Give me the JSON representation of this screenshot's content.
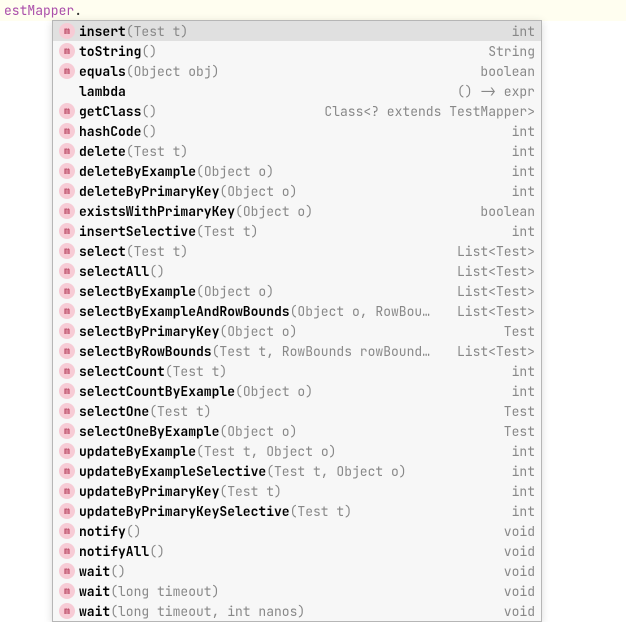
{
  "code_line": {
    "prefix": "estMapper",
    "dot": "."
  },
  "popup": {
    "rows": [
      {
        "icon": "m",
        "name": "insert",
        "params": "(Test t)",
        "ret": "int",
        "selected": true
      },
      {
        "icon": "m",
        "name": "toString",
        "params": "()",
        "ret": "String",
        "selected": false
      },
      {
        "icon": "m",
        "name": "equals",
        "params": "(Object obj)",
        "ret": "boolean",
        "selected": false
      },
      {
        "icon": "",
        "name": "lambda",
        "params": "",
        "ret": "() -> expr",
        "selected": false
      },
      {
        "icon": "m",
        "name": "getClass",
        "params": "()",
        "ret": "Class<? extends TestMapper>",
        "selected": false
      },
      {
        "icon": "m",
        "name": "hashCode",
        "params": "()",
        "ret": "int",
        "selected": false
      },
      {
        "icon": "m",
        "name": "delete",
        "params": "(Test t)",
        "ret": "int",
        "selected": false
      },
      {
        "icon": "m",
        "name": "deleteByExample",
        "params": "(Object o)",
        "ret": "int",
        "selected": false
      },
      {
        "icon": "m",
        "name": "deleteByPrimaryKey",
        "params": "(Object o)",
        "ret": "int",
        "selected": false
      },
      {
        "icon": "m",
        "name": "existsWithPrimaryKey",
        "params": "(Object o)",
        "ret": "boolean",
        "selected": false
      },
      {
        "icon": "m",
        "name": "insertSelective",
        "params": "(Test t)",
        "ret": "int",
        "selected": false
      },
      {
        "icon": "m",
        "name": "select",
        "params": "(Test t)",
        "ret": "List<Test>",
        "selected": false
      },
      {
        "icon": "m",
        "name": "selectAll",
        "params": "()",
        "ret": "List<Test>",
        "selected": false
      },
      {
        "icon": "m",
        "name": "selectByExample",
        "params": "(Object o)",
        "ret": "List<Test>",
        "selected": false
      },
      {
        "icon": "m",
        "name": "selectByExampleAndRowBounds",
        "params": "(Object o, RowBou…",
        "ret": "List<Test>",
        "selected": false
      },
      {
        "icon": "m",
        "name": "selectByPrimaryKey",
        "params": "(Object o)",
        "ret": "Test",
        "selected": false
      },
      {
        "icon": "m",
        "name": "selectByRowBounds",
        "params": "(Test t, RowBounds rowBound…",
        "ret": "List<Test>",
        "selected": false
      },
      {
        "icon": "m",
        "name": "selectCount",
        "params": "(Test t)",
        "ret": "int",
        "selected": false
      },
      {
        "icon": "m",
        "name": "selectCountByExample",
        "params": "(Object o)",
        "ret": "int",
        "selected": false
      },
      {
        "icon": "m",
        "name": "selectOne",
        "params": "(Test t)",
        "ret": "Test",
        "selected": false
      },
      {
        "icon": "m",
        "name": "selectOneByExample",
        "params": "(Object o)",
        "ret": "Test",
        "selected": false
      },
      {
        "icon": "m",
        "name": "updateByExample",
        "params": "(Test t, Object o)",
        "ret": "int",
        "selected": false
      },
      {
        "icon": "m",
        "name": "updateByExampleSelective",
        "params": "(Test t, Object o)",
        "ret": "int",
        "selected": false
      },
      {
        "icon": "m",
        "name": "updateByPrimaryKey",
        "params": "(Test t)",
        "ret": "int",
        "selected": false
      },
      {
        "icon": "m",
        "name": "updateByPrimaryKeySelective",
        "params": "(Test t)",
        "ret": "int",
        "selected": false
      },
      {
        "icon": "m",
        "name": "notify",
        "params": "()",
        "ret": "void",
        "selected": false
      },
      {
        "icon": "m",
        "name": "notifyAll",
        "params": "()",
        "ret": "void",
        "selected": false
      },
      {
        "icon": "m",
        "name": "wait",
        "params": "()",
        "ret": "void",
        "selected": false
      },
      {
        "icon": "m",
        "name": "wait",
        "params": "(long timeout)",
        "ret": "void",
        "selected": false
      },
      {
        "icon": "m",
        "name": "wait",
        "params": "(long timeout, int nanos)",
        "ret": "void",
        "selected": false
      }
    ]
  }
}
